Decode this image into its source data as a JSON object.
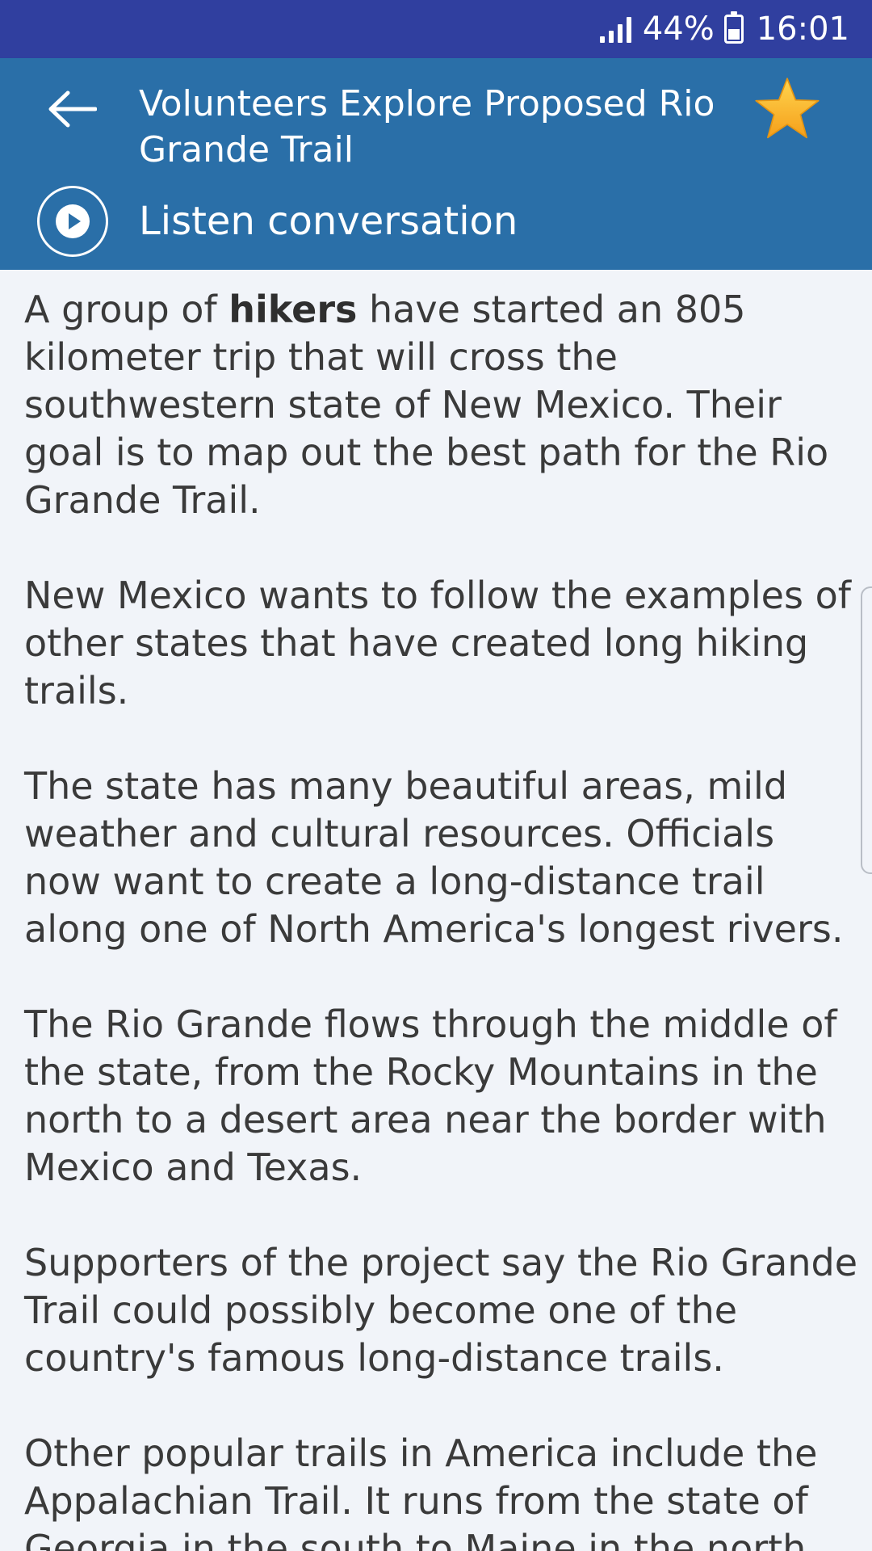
{
  "status_bar": {
    "battery_percent": "44%",
    "time": "16:01"
  },
  "header": {
    "title": "Volunteers Explore Proposed Rio Grande Trail",
    "listen_label": "Listen conversation",
    "colors": {
      "status_bar": "#303f9f",
      "app_bar": "#2a6fa8",
      "star": "#f6b327"
    },
    "icons": [
      "back-arrow-icon",
      "star-icon",
      "play-icon"
    ]
  },
  "article": {
    "p1_before": "A group of ",
    "p1_bold": "hikers",
    "p1_after": " have started an 805 kilometer trip that will cross the southwestern state of New Mexico. Their goal is to map out the best path for the Rio Grande Trail.",
    "p2": "New Mexico wants to follow the examples of other states that have created long hiking trails.",
    "p3": "The state has many beautiful areas, mild weather and cultural resources. Officials now want to create a long-distance trail along one of North America's longest rivers.",
    "p4": "The Rio Grande flows through the middle of the state, from the Rocky Mountains in the north to a desert area near the border with Mexico and Texas.",
    "p5": "Supporters of the project say the Rio Grande Trail could possibly become one of the country's famous long-distance trails.",
    "p6": "Other popular trails in America include the Appalachian Trail. It runs from the state of Georgia in the south to Maine in the north. The Continental Divide Trail that"
  }
}
